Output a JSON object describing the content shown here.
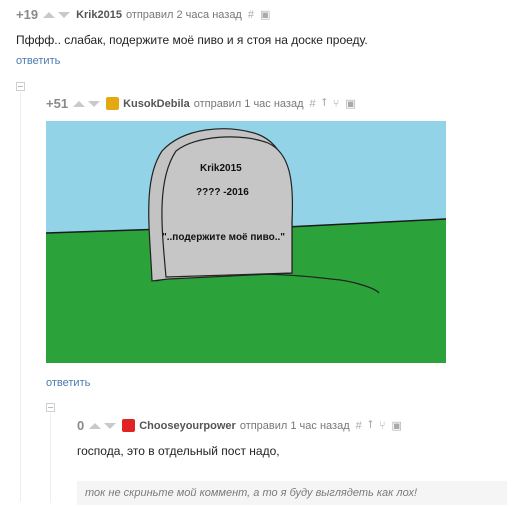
{
  "comments": [
    {
      "rating": "+19",
      "author": "Krik2015",
      "meta": "отправил 2 часа назад",
      "text": "Пффф.. слабак, подержите моё пиво и я стоя на доске проеду.",
      "reply_label": "ответить"
    },
    {
      "rating": "+51",
      "author": "KusokDebila",
      "meta": "отправил 1 час назад",
      "reply_label": "ответить",
      "image": {
        "tomb_name": "Krik2015",
        "tomb_dates": "???? -2016",
        "tomb_quote": "\"..подержите моё пиво..\""
      }
    },
    {
      "rating": "0",
      "author": "Chooseyourpower",
      "meta": "отправил 1 час назад",
      "text": "господа, это в отдельный пост надо,",
      "quote": "ток не скриньте мой коммент, а то я буду выглядеть как лох!"
    }
  ],
  "icons": {
    "hash": "#",
    "up": "⭡",
    "branch": "⑂",
    "save": "▣"
  },
  "colors": {
    "sky": "#92d3e8",
    "grass": "#2ba33a",
    "stone": "#c3c3c3",
    "avatar2": "#e4a912",
    "avatar3": "#e02424",
    "link": "#4a7bb0"
  }
}
